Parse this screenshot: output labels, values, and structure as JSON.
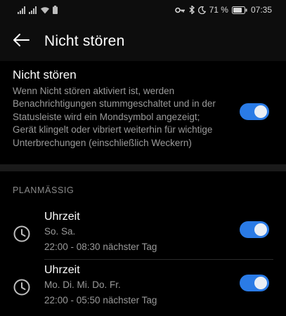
{
  "status_bar": {
    "battery_percent": "71 %",
    "clock": "07:35",
    "icons": [
      "signal-icon",
      "signal-icon",
      "wifi-icon",
      "battery-saver-icon",
      "key-icon",
      "bluetooth-icon",
      "moon-icon",
      "battery-icon"
    ]
  },
  "header": {
    "title": "Nicht stören",
    "back_icon": "arrow-left-icon"
  },
  "dnd": {
    "title": "Nicht stören",
    "description": "Wenn Nicht stören aktiviert ist, werden Benachrichtigungen stummgeschaltet und in der Statusleiste wird ein Mondsymbol angezeigt; Gerät klingelt oder vibriert weiterhin für wichtige Unterbrechungen (einschließlich Weckern)",
    "enabled": true
  },
  "schedule": {
    "section_label": "PLANMÄSSIG",
    "items": [
      {
        "title": "Uhrzeit",
        "days": "So. Sa.",
        "time": "22:00 - 08:30 nächster Tag",
        "enabled": true,
        "icon": "clock-icon"
      },
      {
        "title": "Uhrzeit",
        "days": "Mo. Di. Mi. Do. Fr.",
        "time": "22:00 - 05:50 nächster Tag",
        "enabled": true,
        "icon": "clock-icon"
      }
    ]
  },
  "colors": {
    "accent": "#2a7be6",
    "background": "#000000",
    "text_primary": "#ffffff",
    "text_secondary": "#9a9a9a"
  }
}
